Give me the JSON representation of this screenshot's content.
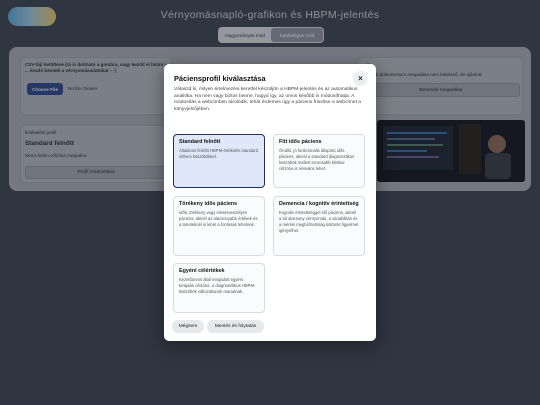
{
  "header": {
    "title": "Vérnyomásnapló-grafikon és HBPM-jelentés",
    "mode_options": [
      "Hagyományos mód",
      "Kardiológus mód"
    ],
    "active_mode": "Kardiológus mód"
  },
  "background": {
    "csv_card": {
      "label": "CSV-fájl betöltése (rá is dobható a gombra, vagy kezdd el húzni a ... kezdő beviteli a vérnyomásadatokat ···)",
      "choose_file": "Choose File",
      "no_file": "No file chosen"
    },
    "right_card": {
      "label": "...ra",
      "text": "...bálhat dokumentum megadása nem kötelező, de ajánlott.",
      "button": "Beteméir megadása"
    },
    "profile_card": {
      "heading": "Értékelési profil",
      "value": "Standard felnőtt",
      "note": "Nincs külön célzóna megadva.",
      "button": "Profil módosítása"
    }
  },
  "modal": {
    "title": "Páciensprofil kiválasztása",
    "close_label": "×",
    "description": "Válaszd ki, milyen értelmezési keretfel készüljön a HBPM-jelentés és az automatikus analitika. Ha nem vagy biztos benne, hagyd így, az orvos később is módosíthatja. A módosítás a webcímben tárolódik, tehát érdemes úgy a páciens frissítse a webcímet a könyvjelzőjében.",
    "options": [
      {
        "title": "Standard felnőtt",
        "desc": "Általános felnőtt HBPM-értékelés standard otthoni küszöbökkel.",
        "selected": true
      },
      {
        "title": "Fitt idős páciens",
        "desc": "Önálló, jó funkcionális állapotú idős páciens, akinél a standard diagnosztikus küszöbök mellett szorosabb klinikai célzóna is releváns lehet.",
        "selected": false
      },
      {
        "title": "Törékeny idős páciens",
        "desc": "Idős, törékeny vagy elesésveszélyes páciens, akinél az alacsonyabb értékek és a tüneteknél is lehet a fontosak lehetnek.",
        "selected": false
      },
      {
        "title": "Demencia / kognitív érintettség",
        "desc": "Kognitív érintettséggel élő páciens, akinél a túl alacsony vérnyomás, a variabilitás és a mérési megbízhatóság különös figyelmet igényelhet.",
        "selected": false
      },
      {
        "title": "Egyéni célértékek",
        "desc": "Kezelőorvos által megadott egyéni terápiás célzóna, a diagnosztikus HBPM-küszöbök változatlanok maradnak.",
        "selected": false
      }
    ],
    "cancel_label": "Mégsem",
    "save_label": "Mentés és folytatás"
  }
}
